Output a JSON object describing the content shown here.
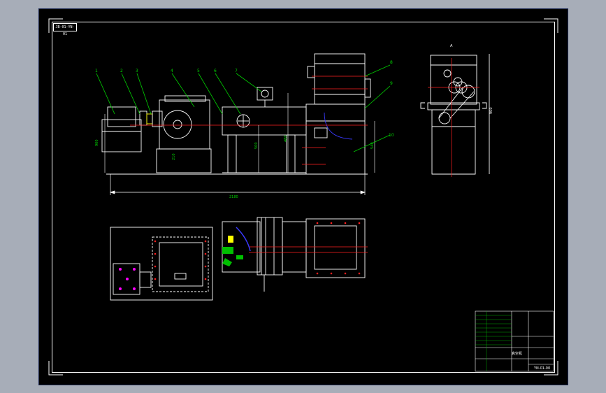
{
  "drawing": {
    "drawing_id": "JB-01-YN-01",
    "overall_length_dim": "2180",
    "heights": [
      "900",
      "500",
      "480",
      "210",
      "200",
      "540"
    ],
    "callouts": [
      "1",
      "2",
      "3",
      "4",
      "5",
      "6",
      "7",
      "8",
      "9",
      "10"
    ],
    "side_view_height": "900",
    "arrow_label": "A"
  },
  "title_block": {
    "name": "真空机",
    "drawing_no": "YN-01-00"
  },
  "colors": {
    "line": "#ffffff",
    "callout": "#00d000",
    "center": "#ff2020",
    "hidden": "#00c8ff",
    "frame_highlight": "#3a3aff",
    "accent": "#ff00ff",
    "yellow": "#ffff00"
  }
}
